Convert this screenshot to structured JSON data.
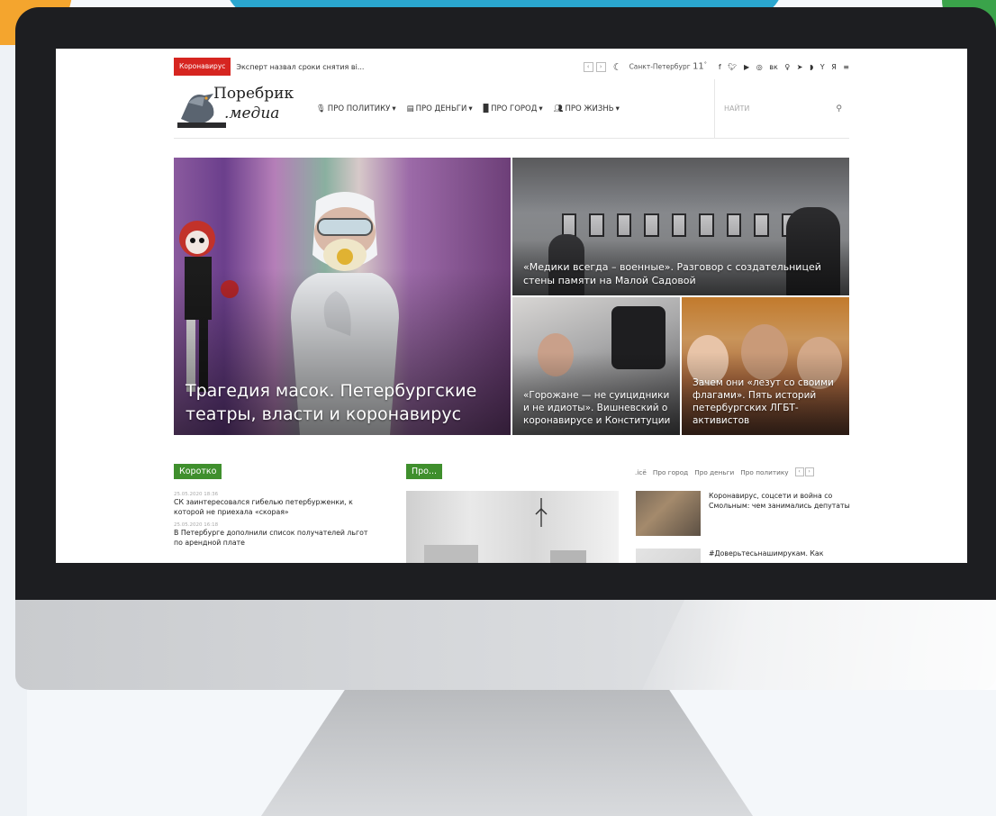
{
  "topbar": {
    "breaking_label": "Коронавирус",
    "ticker_text": "Эксперт назвал сроки снятия ві...",
    "prev_arrow": "‹",
    "next_arrow": "›",
    "city": "Санкт-Петербург",
    "temperature": "11",
    "temp_unit": "°",
    "social_icons": [
      "moon-icon",
      "facebook-icon",
      "twitter-icon",
      "youtube-icon",
      "instagram-icon",
      "vk-icon",
      "odnoklassniki-icon",
      "telegram-icon",
      "rss-icon",
      "yandex-zen-icon",
      "yandex-icon",
      "menu-icon"
    ]
  },
  "header": {
    "logo_line1": "Поребрик",
    "logo_line2": ".медиа",
    "nav": [
      {
        "label": "ПРО ПОЛИТИКУ",
        "icon": "microphone-icon"
      },
      {
        "label": "ПРО ДЕНЬГИ",
        "icon": "money-icon"
      },
      {
        "label": "ПРО ГОРОД",
        "icon": "building-icon"
      },
      {
        "label": "ПРО ЖИЗНЬ",
        "icon": "people-icon"
      }
    ],
    "search_placeholder": "НАЙТИ"
  },
  "hero": {
    "main_caption": "Трагедия масок. Петербургские театры, власти и коронавирус",
    "top_right_caption": "«Медики всегда – военные». Разговор с создательницей стены памяти на Малой Садовой",
    "bottom_left_caption": "«Горожане — не суицидники и не идиоты». Вишневский о коронавирусе и Конституции",
    "bottom_right_caption": "Зачем они «лезут со своими флагами». Пять историй петербургских ЛГБТ-активистов"
  },
  "briefly": {
    "tag": "Коротко",
    "items": [
      {
        "date": "25.05.2020 18:36",
        "title": "СК заинтересовался гибелью петербурженки, к которой не приехала «скорая»"
      },
      {
        "date": "25.05.2020 16:18",
        "title": "В Петербурге дополнили список получателей льгот по арендной плате"
      }
    ]
  },
  "middle": {
    "tag": "Про..."
  },
  "side": {
    "tabs": [
      ".ісё",
      "Про город",
      "Про деньги",
      "Про политику"
    ],
    "items": [
      {
        "title": "Коронавирус, соцсети и война со Смольным: чем занимались депутаты"
      },
      {
        "title": "#Доверьтесьнашимрукам. Как"
      }
    ]
  }
}
